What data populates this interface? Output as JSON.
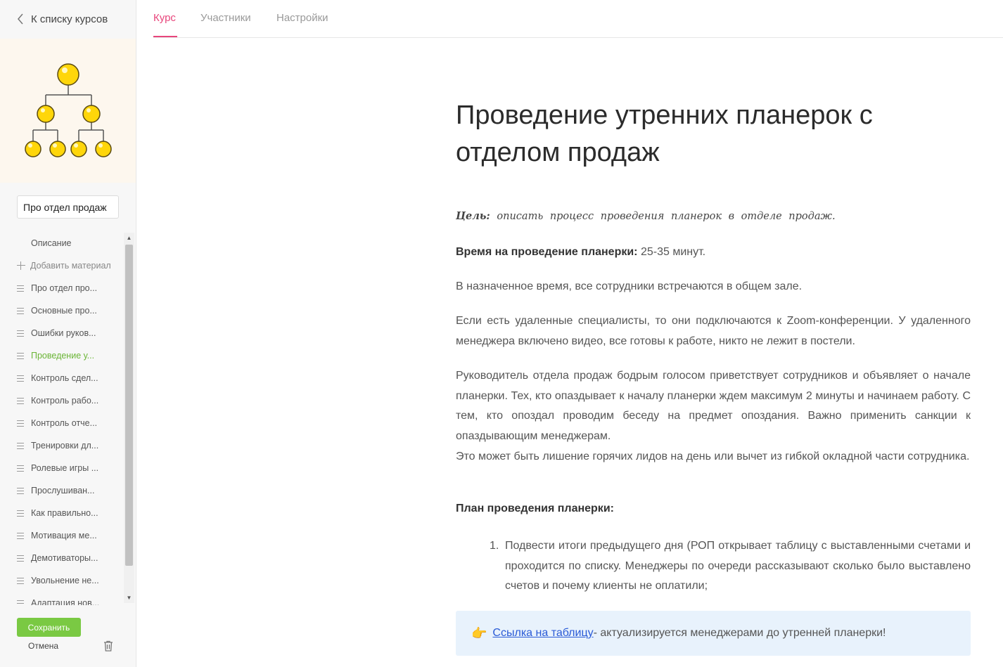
{
  "sidebar": {
    "back_label": "К списку курсов",
    "course_title": "Про отдел продаж",
    "lessons": [
      {
        "label": "Описание",
        "type": "plain"
      },
      {
        "label": "Добавить материал",
        "type": "add"
      },
      {
        "label": "Про отдел про...",
        "type": "lesson"
      },
      {
        "label": "Основные про...",
        "type": "lesson"
      },
      {
        "label": "Ошибки руков...",
        "type": "lesson"
      },
      {
        "label": "Проведение у...",
        "type": "lesson",
        "active": true
      },
      {
        "label": "Контроль сдел...",
        "type": "lesson"
      },
      {
        "label": "Контроль рабо...",
        "type": "lesson"
      },
      {
        "label": "Контроль отче...",
        "type": "lesson"
      },
      {
        "label": "Тренировки дл...",
        "type": "lesson"
      },
      {
        "label": "Ролевые игры ...",
        "type": "lesson"
      },
      {
        "label": "Прослушиван...",
        "type": "lesson"
      },
      {
        "label": "Как правильно...",
        "type": "lesson"
      },
      {
        "label": "Мотивация ме...",
        "type": "lesson"
      },
      {
        "label": "Демотиваторы...",
        "type": "lesson"
      },
      {
        "label": "Увольнение не...",
        "type": "lesson"
      },
      {
        "label": "Адаптация нов...",
        "type": "lesson"
      }
    ],
    "save_label": "Сохранить",
    "cancel_label": "Отмена"
  },
  "tabs": [
    {
      "label": "Курс",
      "active": true
    },
    {
      "label": "Участники"
    },
    {
      "label": "Настройки"
    }
  ],
  "article": {
    "title": "Проведение утренних планерок с отделом продаж",
    "goal_label": "Цель:",
    "goal_text": " описать процесс проведения планерок в отделе продаж.",
    "time_label": "Время на проведение планерки:",
    "time_value": " 25-35 минут.",
    "p1": "В назначенное время, все сотрудники встречаются в общем зале.",
    "p2": "Если есть удаленные специалисты, то они подключаются к Zoom-конференции. У удаленного менеджера включено видео, все готовы к работе, никто не лежит в постели.",
    "p3": "Руководитель отдела продаж бодрым голосом приветствует сотрудников и объявляет о начале планерки. Тех, кто опаздывает к началу планерки ждем максимум 2 минуты и начинаем работу. С тем, кто опоздал проводим беседу на предмет опоздания. Важно применить санкции к опаздывающим менеджерам.",
    "p4": "Это может быть лишение горячих лидов на день или вычет из гибкой окладной части сотрудника.",
    "plan_title": "План проведения планерки:",
    "plan_items": [
      {
        "num": "1.",
        "text": "Подвести итоги предыдущего дня (РОП открывает таблицу с выставленными счетами и проходится по списку. Менеджеры по очереди рассказывают сколько было выставлено счетов и почему клиенты не оплатили;"
      }
    ],
    "callout_icon": "👉",
    "callout_link": "Ссылка на таблицу",
    "callout_text": " - актуализируется менеджерами до утренней планерки!"
  },
  "colors": {
    "accent_tab": "#e8467c",
    "active_lesson": "#6bb536",
    "save_button": "#7ac943",
    "callout_bg": "#e8f2fc",
    "link": "#2a5bd7"
  }
}
